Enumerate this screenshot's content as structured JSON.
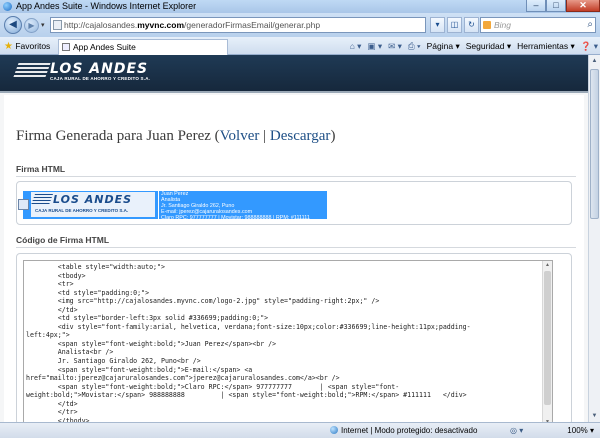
{
  "window": {
    "title": "App Andes Suite - Windows Internet Explorer",
    "controls": {
      "minimize": "–",
      "maximize": "□",
      "close": "✕"
    }
  },
  "browser": {
    "url_prefix": "http://cajalosandes.",
    "url_domain": "myvnc.com",
    "url_path": "/generadorFirmasEmail/generar.php",
    "search_placeholder": "Bing",
    "search_go": "⌕",
    "back": "◀",
    "forward": "▶",
    "nav_dropdown": "▾",
    "url_tools": [
      "▾",
      "◫",
      "↻",
      "✕"
    ],
    "favorites_label": "Favoritos",
    "favorites_icon": "★",
    "tab_title": "App Andes Suite",
    "commands": [
      "⌂ ▾",
      "▣ ▾",
      "✉ ▾",
      "⎙ ▾",
      "Página ▾",
      "Seguridad ▾",
      "Herramientas ▾",
      "❓ ▾"
    ]
  },
  "site": {
    "logo_main": "LOS ANDES",
    "logo_sub": "CAJA RURAL DE AHORRO Y CREDITO S.A."
  },
  "page": {
    "title_prefix": "Firma Generada para Juan Perez (",
    "link_back": "Volver",
    "sep": " | ",
    "link_download": "Descargar",
    "title_suffix": ")",
    "section_html": "Firma HTML",
    "section_code": "Código de Firma HTML"
  },
  "signature": {
    "logo_main": "LOS ANDES",
    "logo_sub": "CAJA RURAL DE AHORRO Y CREDITO S.A.",
    "lines": [
      "Juan Perez",
      "Analista",
      "Jr. Santiago Giraldo 262, Puno",
      "E-mail: jperez@cajaruralosandes.com",
      "Claro RPC: 977777777 | Movistar: 988888888 | RPM: #111111"
    ]
  },
  "code": {
    "lines": [
      "        <table style=\"width:auto;\">",
      "        <tbody>",
      "        <tr>",
      "        <td style=\"padding:0;\">",
      "        <img src=\"http://cajalosandes.myvnc.com/logo-2.jpg\" style=\"padding-right:2px;\" />",
      "        </td>",
      "        <td style=\"border-left:3px solid #336699;padding:0;\">",
      "        <div style=\"font-family:arial, helvetica, verdana;font-size:10px;color:#336699;line-height:11px;padding-",
      "left:4px;\">",
      "        <span style=\"font-weight:bold;\">Juan Perez</span><br />",
      "        Analista<br />",
      "        Jr. Santiago Giraldo 262, Puno<br />",
      "        <span style=\"font-weight:bold;\">E-mail:</span> <a",
      "href=\"mailto:jperez@cajaruralosandes.com\">jperez@cajaruralosandes.com</a><br />",
      "        <span style=\"font-weight:bold;\">Claro RPC:</span> 977777777       | <span style=\"font-",
      "weight:bold;\">Movistar:</span> 988888888         | <span style=\"font-weight:bold;\">RPM:</span> #111111   </div>",
      "        </td>",
      "        </tr>",
      "        </tbody>"
    ]
  },
  "status": {
    "zone": "Internet | Modo protegido: desactivado",
    "icons": "◎ ▾",
    "zoom": "100%  ▾"
  },
  "colors": {
    "link": "#1e4f86",
    "header_bg": "#1f3a55",
    "selection": "#3399ff"
  }
}
